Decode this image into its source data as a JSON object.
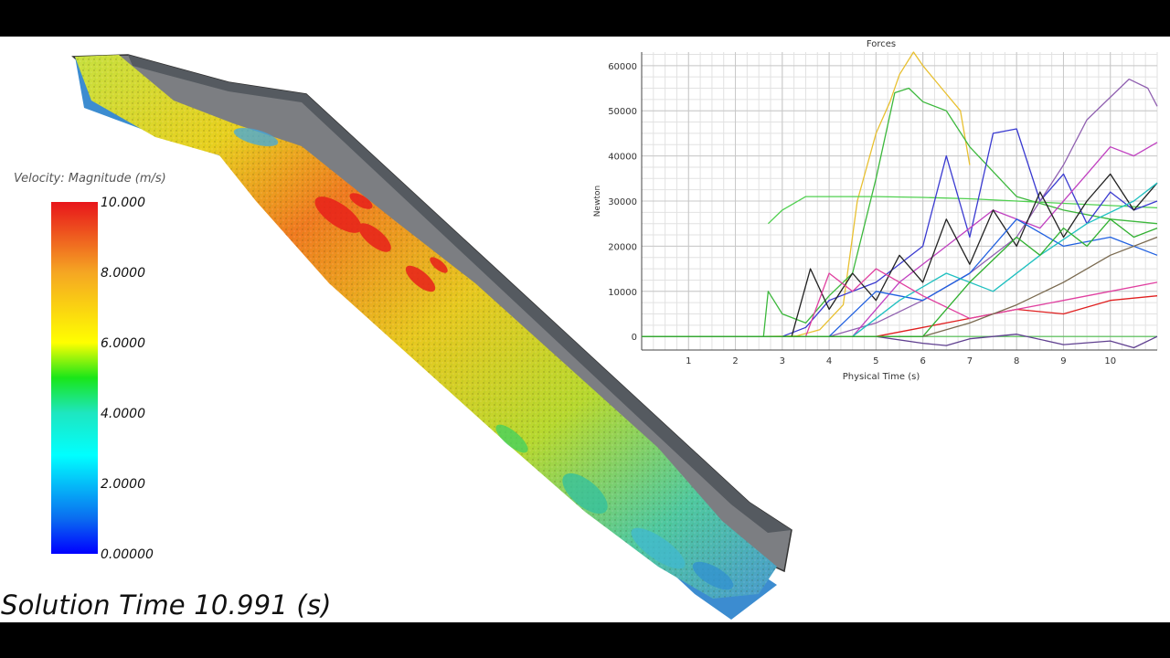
{
  "legend": {
    "title": "Velocity: Magnitude (m/s)",
    "ticks": [
      "10.000",
      "8.0000",
      "6.0000",
      "4.0000",
      "2.0000",
      "0.00000"
    ]
  },
  "solution_time": "Solution Time 10.991 (s)",
  "chart_data": {
    "type": "line",
    "title": "Forces",
    "xlabel": "Physical Time (s)",
    "ylabel": "Newton",
    "xlim": [
      0,
      11
    ],
    "ylim": [
      -3000,
      63000
    ],
    "x_ticks": [
      1,
      2,
      3,
      4,
      5,
      6,
      7,
      8,
      9,
      10
    ],
    "y_ticks": [
      0,
      10000,
      20000,
      30000,
      40000,
      50000,
      60000
    ],
    "grid": true,
    "series": [
      {
        "color": "#e8c030",
        "x": [
          0,
          2.6,
          3.3,
          3.8,
          4.3,
          4.6,
          5.0,
          5.3,
          5.5,
          5.8,
          6.0,
          6.4,
          6.8,
          7.0
        ],
        "y": [
          0,
          0,
          100,
          1500,
          7000,
          30000,
          45000,
          52000,
          58000,
          63000,
          60000,
          55000,
          50000,
          38000
        ]
      },
      {
        "color": "#3cb83c",
        "x": [
          0,
          2.6,
          2.7,
          3.0,
          3.5,
          4.0,
          4.5,
          5.0,
          5.4,
          5.7,
          6.0,
          6.5,
          7.0,
          8.0,
          9.0,
          10.0,
          11.0
        ],
        "y": [
          0,
          0,
          10000,
          5000,
          3000,
          9000,
          14000,
          35000,
          54000,
          55000,
          52000,
          50000,
          42000,
          31000,
          28000,
          26000,
          25000
        ]
      },
      {
        "color": "#50d050",
        "x": [
          2.7,
          3.0,
          3.5,
          4.0,
          5.0,
          6.0,
          7.0,
          8.0,
          9.0,
          10.0,
          11.0
        ],
        "y": [
          25000,
          28000,
          31000,
          31000,
          31000,
          30800,
          30500,
          30000,
          29500,
          29000,
          28500
        ]
      },
      {
        "color": "#3a3ad0",
        "x": [
          0,
          3.0,
          3.5,
          4.0,
          5.0,
          6.0,
          6.5,
          7.0,
          7.5,
          8.0,
          8.5,
          9.0,
          9.5,
          10.0,
          10.5,
          11.0
        ],
        "y": [
          0,
          0,
          2000,
          8000,
          12000,
          20000,
          40000,
          22000,
          45000,
          46000,
          30000,
          36000,
          25000,
          32000,
          28000,
          30000
        ]
      },
      {
        "color": "#9060b0",
        "x": [
          0,
          4.0,
          5.0,
          6.0,
          7.0,
          8.0,
          9.0,
          9.5,
          10.0,
          10.4,
          10.8,
          11.0
        ],
        "y": [
          0,
          0,
          3000,
          8000,
          14000,
          22000,
          38000,
          48000,
          53000,
          57000,
          55000,
          51000
        ]
      },
      {
        "color": "#c040c0",
        "x": [
          0,
          4.5,
          5.5,
          6.5,
          7.5,
          8.5,
          9.5,
          10.0,
          10.5,
          11.0
        ],
        "y": [
          0,
          0,
          12000,
          20000,
          28000,
          24000,
          36000,
          42000,
          40000,
          43000
        ]
      },
      {
        "color": "#222222",
        "x": [
          0,
          3.2,
          3.6,
          4.0,
          4.5,
          5.0,
          5.5,
          6.0,
          6.5,
          7.0,
          7.5,
          8.0,
          8.5,
          9.0,
          9.5,
          10.0,
          10.5,
          11.0
        ],
        "y": [
          0,
          0,
          15000,
          6000,
          14000,
          8000,
          18000,
          12000,
          26000,
          16000,
          28000,
          20000,
          32000,
          22000,
          30000,
          36000,
          28000,
          34000
        ]
      },
      {
        "color": "#2060e0",
        "x": [
          0,
          4.0,
          5.0,
          6.0,
          7.0,
          8.0,
          9.0,
          10.0,
          11.0
        ],
        "y": [
          0,
          0,
          10000,
          8000,
          14000,
          26000,
          20000,
          22000,
          18000
        ]
      },
      {
        "color": "#20c0c0",
        "x": [
          0,
          4.5,
          5.5,
          6.5,
          7.5,
          8.5,
          9.5,
          10.5,
          11.0
        ],
        "y": [
          0,
          0,
          8000,
          14000,
          10000,
          18000,
          25000,
          30000,
          34000
        ]
      },
      {
        "color": "#e02020",
        "x": [
          0,
          5.0,
          6.0,
          7.0,
          8.0,
          9.0,
          10.0,
          11.0
        ],
        "y": [
          0,
          0,
          2000,
          4000,
          6000,
          5000,
          8000,
          9000
        ]
      },
      {
        "color": "#e040a0",
        "x": [
          0,
          3.5,
          4.0,
          4.5,
          5.0,
          6.0,
          7.0,
          8.0,
          9.0,
          10.0,
          11.0
        ],
        "y": [
          0,
          0,
          14000,
          10000,
          15000,
          9000,
          4000,
          6000,
          8000,
          10000,
          12000
        ]
      },
      {
        "color": "#604090",
        "x": [
          0,
          5.0,
          6.0,
          6.5,
          7.0,
          8.0,
          9.0,
          10.0,
          10.5,
          11.0
        ],
        "y": [
          0,
          0,
          -1500,
          -2000,
          -500,
          500,
          -1800,
          -1000,
          -2500,
          0
        ]
      },
      {
        "color": "#7a6a50",
        "x": [
          0,
          6.0,
          7.0,
          8.0,
          9.0,
          10.0,
          11.0
        ],
        "y": [
          0,
          0,
          3000,
          7000,
          12000,
          18000,
          22000
        ]
      },
      {
        "color": "#30b030",
        "x": [
          0,
          6.0,
          7.0,
          8.0,
          8.5,
          9.0,
          9.5,
          10.0,
          10.5,
          11.0
        ],
        "y": [
          0,
          0,
          12000,
          22000,
          18000,
          24000,
          20000,
          26000,
          22000,
          24000
        ]
      }
    ]
  }
}
